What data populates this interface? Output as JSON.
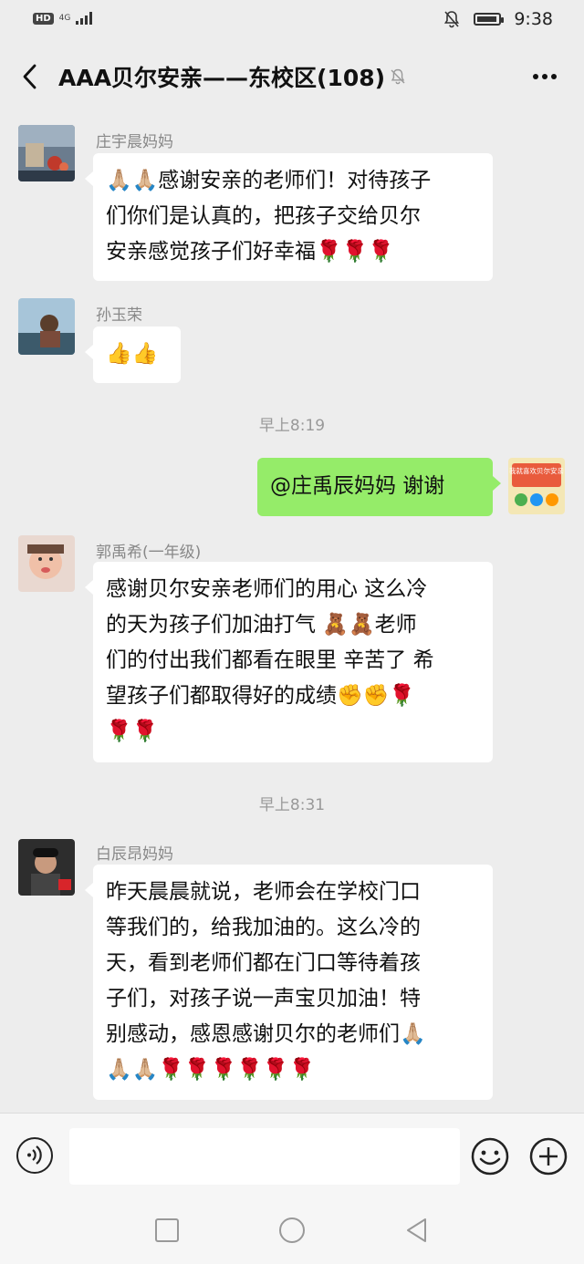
{
  "status_bar": {
    "hd_label": "HD",
    "network_label": "4G",
    "time": "9:38"
  },
  "header": {
    "title": "AAA贝尔安亲——东校区(108)",
    "back_icon": "chevron-left-icon",
    "mute_icon": "bell-slash-icon",
    "more_icon": "more-dots-icon"
  },
  "messages": [
    {
      "type": "in",
      "sender": "庄宇晨妈妈",
      "lines": [
        "🙏🏼🙏🏼感谢安亲的老师们！对待孩子",
        "们你们是认真的，把孩子交给贝尔",
        "安亲感觉孩子们好幸福🌹🌹🌹"
      ]
    },
    {
      "type": "in",
      "sender": "孙玉荣",
      "lines": [
        "👍👍"
      ]
    },
    {
      "type": "time",
      "text": "早上8:19"
    },
    {
      "type": "out",
      "lines": [
        "@庄禹辰妈妈  谢谢"
      ]
    },
    {
      "type": "in",
      "sender": "郭禹希(一年级)",
      "lines": [
        "感谢贝尔安亲老师们的用心 这么冷",
        "的天为孩子们加油打气 🧸🧸老师",
        "们的付出我们都看在眼里 辛苦了 希",
        "望孩子们都取得好的成绩✊✊🌹",
        "🌹🌹"
      ]
    },
    {
      "type": "time",
      "text": "早上8:31"
    },
    {
      "type": "in",
      "sender": "白辰昂妈妈",
      "lines": [
        "昨天晨晨就说，老师会在学校门口",
        "等我们的，给我加油的。这么冷的",
        "天，看到老师们都在门口等待着孩",
        "子们，对孩子说一声宝贝加油！特",
        "别感动，感恩感谢贝尔的老师们🙏🏼",
        "🙏🏼🙏🏼🌹🌹🌹🌹🌹🌹"
      ]
    }
  ],
  "self_avatar_text": "我就喜欢贝尔安亲",
  "input_bar": {
    "placeholder": "",
    "voice_icon": "voice-icon",
    "emoji_icon": "smiley-icon",
    "plus_icon": "plus-icon"
  },
  "nav_bar": {
    "recent_icon": "square-icon",
    "home_icon": "circle-icon",
    "back_icon": "triangle-back-icon"
  }
}
